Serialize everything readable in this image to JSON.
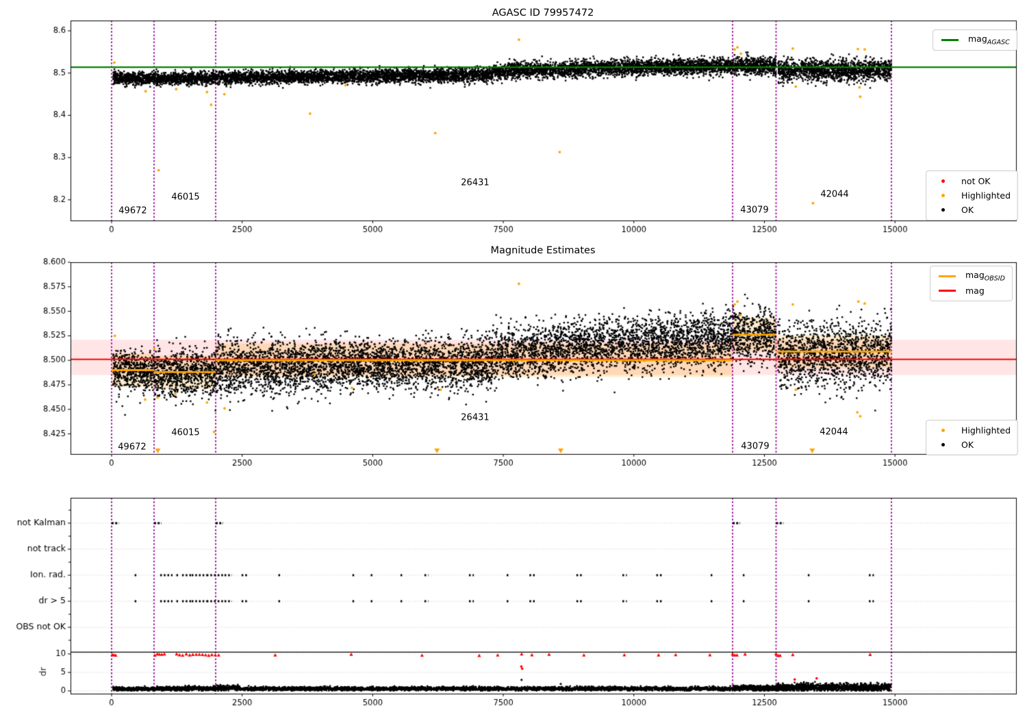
{
  "figure": {
    "top_title": "AGASC ID 79957472",
    "middle_title": "Magnitude Estimates"
  },
  "colors": {
    "ok": "#000000",
    "highlighted": "#ffa500",
    "not_ok": "#ff0000",
    "mag_agasc_line": "#008000",
    "mag_line": "#ff0000",
    "mag_obsid_line": "#ffa500",
    "obsid_boundary": "#990099",
    "mag_band_fill": "rgba(255,0,0,0.10)",
    "obsid_band_fill": "rgba(255,165,0,0.20)",
    "grid": "#c8c8c8",
    "threshold_line": "#000000"
  },
  "obsids": [
    {
      "id": "49672",
      "start": 0,
      "end": 813
    },
    {
      "id": "46015",
      "start": 813,
      "end": 1993
    },
    {
      "id": "26431",
      "start": 1993,
      "end": 11891
    },
    {
      "id": "43079",
      "start": 11891,
      "end": 12723
    },
    {
      "id": "42044",
      "start": 12723,
      "end": 14932
    }
  ],
  "chart_data": [
    {
      "type": "scatter",
      "title": "AGASC ID 79957472",
      "x_ticks": [
        0,
        2500,
        5000,
        7500,
        10000,
        12500,
        15000
      ],
      "y_ticks": [
        8.6,
        8.5,
        8.4,
        8.3,
        8.2
      ],
      "y_tick_decimals": 1,
      "ylim": [
        8.151,
        8.624
      ],
      "mag_agasc": 8.514,
      "boundaries": [
        0,
        813,
        1993,
        11891,
        12723,
        14932
      ],
      "legend_top": [
        {
          "marker": "line",
          "color": "#008000",
          "label": "mag",
          "sub": "AGASC"
        }
      ],
      "legend_bottom": [
        {
          "marker": "dot",
          "color": "#ff0000",
          "label": "not OK"
        },
        {
          "marker": "dot",
          "color": "#ffa500",
          "label": "Highlighted"
        },
        {
          "marker": "dot",
          "color": "#000000",
          "label": "OK"
        }
      ],
      "band_segments": [
        {
          "x0": 30,
          "x1": 813,
          "m0": 8.488,
          "m1": 8.487,
          "std": 0.0075,
          "n": 500
        },
        {
          "x0": 813,
          "x1": 1993,
          "m0": 8.487,
          "m1": 8.488,
          "std": 0.0075,
          "n": 750
        },
        {
          "x0": 1993,
          "x1": 5000,
          "m0": 8.489,
          "m1": 8.4925,
          "std": 0.0075,
          "n": 1900
        },
        {
          "x0": 5000,
          "x1": 7300,
          "m0": 8.4925,
          "m1": 8.497,
          "std": 0.008,
          "n": 1450
        },
        {
          "x0": 7300,
          "x1": 9000,
          "m0": 8.503,
          "m1": 8.51,
          "std": 0.0095,
          "n": 1050
        },
        {
          "x0": 9000,
          "x1": 11891,
          "m0": 8.511,
          "m1": 8.517,
          "std": 0.0095,
          "n": 1800
        },
        {
          "x0": 11891,
          "x1": 12723,
          "m0": 8.517,
          "m1": 8.517,
          "std": 0.011,
          "n": 520
        },
        {
          "x0": 12760,
          "x1": 14932,
          "m0": 8.506,
          "m1": 8.508,
          "std": 0.013,
          "n": 1350
        }
      ],
      "tail": 0.008,
      "tail_prob": 0.05,
      "highlighted": [
        [
          52,
          8.525
        ],
        [
          651,
          8.457
        ],
        [
          900,
          8.27
        ],
        [
          1236,
          8.462
        ],
        [
          1827,
          8.455
        ],
        [
          1905,
          8.425
        ],
        [
          2159,
          8.45
        ],
        [
          3800,
          8.404
        ],
        [
          4480,
          8.471
        ],
        [
          6197,
          8.358
        ],
        [
          7800,
          8.579
        ],
        [
          8580,
          8.313
        ],
        [
          11930,
          8.556
        ],
        [
          11983,
          8.561
        ],
        [
          12050,
          8.546
        ],
        [
          13043,
          8.558
        ],
        [
          13100,
          8.468
        ],
        [
          13430,
          8.192
        ],
        [
          14290,
          8.557
        ],
        [
          14420,
          8.556
        ],
        [
          14320,
          8.466
        ],
        [
          14335,
          8.444
        ]
      ],
      "obsid_labels": [
        {
          "text": "49672",
          "x": 406,
          "y": 8.174
        },
        {
          "text": "46015",
          "x": 1416,
          "y": 8.206
        },
        {
          "text": "26431",
          "x": 6961,
          "y": 8.24
        },
        {
          "text": "43079",
          "x": 12310,
          "y": 8.175
        },
        {
          "text": "42044",
          "x": 13844,
          "y": 8.213
        }
      ]
    },
    {
      "type": "scatter",
      "title": "Magnitude Estimates",
      "x_ticks": [
        0,
        2500,
        5000,
        7500,
        10000,
        12500,
        15000
      ],
      "y_ticks": [
        8.6,
        8.575,
        8.55,
        8.525,
        8.5,
        8.475,
        8.45,
        8.425
      ],
      "y_tick_decimals": 3,
      "ylim": [
        8.404,
        8.6
      ],
      "mag": 8.501,
      "mag_band": [
        8.485,
        8.521
      ],
      "obsid_band_halfwidth": 0.017,
      "boundaries": [
        0,
        813,
        1993,
        11891,
        12723,
        14932
      ],
      "mag_obsid_segments": [
        {
          "x0": 0,
          "x1": 813,
          "y": 8.49
        },
        {
          "x0": 813,
          "x1": 1993,
          "y": 8.488
        },
        {
          "x0": 1993,
          "x1": 11891,
          "y": 8.5
        },
        {
          "x0": 11891,
          "x1": 12723,
          "y": 8.526
        },
        {
          "x0": 12723,
          "x1": 14932,
          "y": 8.509
        }
      ],
      "legend_top": [
        {
          "marker": "line",
          "color": "#ffa500",
          "label": "mag",
          "sub": "OBSID"
        },
        {
          "marker": "line",
          "color": "#ff0000",
          "label": "mag"
        }
      ],
      "legend_bottom": [
        {
          "marker": "dot",
          "color": "#ffa500",
          "label": "Highlighted"
        },
        {
          "marker": "dot",
          "color": "#000000",
          "label": "OK"
        }
      ],
      "band_segments": [
        {
          "x0": 30,
          "x1": 813,
          "m0": 8.49,
          "m1": 8.489,
          "std": 0.009,
          "n": 500
        },
        {
          "x0": 813,
          "x1": 1993,
          "m0": 8.488,
          "m1": 8.489,
          "std": 0.011,
          "n": 750
        },
        {
          "x0": 1993,
          "x1": 2450,
          "m0": 8.492,
          "m1": 8.492,
          "std": 0.015,
          "n": 300
        },
        {
          "x0": 2450,
          "x1": 5000,
          "m0": 8.494,
          "m1": 8.496,
          "std": 0.013,
          "n": 1650
        },
        {
          "x0": 5000,
          "x1": 7300,
          "m0": 8.496,
          "m1": 8.498,
          "std": 0.012,
          "n": 1450
        },
        {
          "x0": 7300,
          "x1": 9000,
          "m0": 8.505,
          "m1": 8.515,
          "std": 0.013,
          "n": 1050
        },
        {
          "x0": 9000,
          "x1": 11891,
          "m0": 8.516,
          "m1": 8.523,
          "std": 0.013,
          "n": 1800
        },
        {
          "x0": 11891,
          "x1": 12723,
          "m0": 8.527,
          "m1": 8.527,
          "std": 0.013,
          "n": 520
        },
        {
          "x0": 12760,
          "x1": 14932,
          "m0": 8.504,
          "m1": 8.508,
          "std": 0.016,
          "n": 1350
        }
      ],
      "tail": 0.022,
      "tail_prob": 0.08,
      "highlighted": [
        [
          62,
          8.525
        ],
        [
          642,
          8.46
        ],
        [
          817,
          8.512
        ],
        [
          880,
          8.462
        ],
        [
          1223,
          8.466
        ],
        [
          1826,
          8.457
        ],
        [
          1962,
          8.427
        ],
        [
          2163,
          8.451
        ],
        [
          3893,
          8.486
        ],
        [
          4600,
          8.472
        ],
        [
          6300,
          8.47
        ],
        [
          7800,
          8.578
        ],
        [
          11930,
          8.557
        ],
        [
          11983,
          8.56
        ],
        [
          12040,
          8.546
        ],
        [
          13043,
          8.557
        ],
        [
          13100,
          8.47
        ],
        [
          14280,
          8.447
        ],
        [
          14300,
          8.56
        ],
        [
          14335,
          8.443
        ],
        [
          14420,
          8.558
        ]
      ],
      "clip_triangles_x": [
        885,
        6230,
        8600,
        13415
      ],
      "obsid_labels": [
        {
          "text": "49672",
          "x": 393,
          "y": 8.4114
        },
        {
          "text": "46015",
          "x": 1416,
          "y": 8.4261
        },
        {
          "text": "26431",
          "x": 6961,
          "y": 8.4415
        },
        {
          "text": "43079",
          "x": 12323,
          "y": 8.4121
        },
        {
          "text": "42044",
          "x": 13830,
          "y": 8.4268
        }
      ]
    },
    {
      "type": "flags",
      "categories": [
        "not Kalman",
        "not track",
        "Ion. rad.",
        "dr > 5",
        "OBS not OK"
      ],
      "dr_ticks": [
        10,
        5,
        0
      ],
      "ylabel": "dr",
      "x_ticks": [
        0,
        2500,
        5000,
        7500,
        10000,
        12500,
        15000
      ],
      "threshold": 10.5,
      "boundaries": [
        0,
        813,
        1993,
        11891,
        12723,
        14932
      ],
      "not_kalman_ranges": [
        [
          0,
          115
        ],
        [
          813,
          930
        ],
        [
          1993,
          2110
        ],
        [
          11891,
          12010
        ],
        [
          12723,
          12840
        ]
      ],
      "flag_ranges": [
        [
          441,
          460
        ],
        [
          930,
          1140
        ],
        [
          1240,
          1258
        ],
        [
          1349,
          1506
        ],
        [
          1533,
          1795
        ],
        [
          1821,
          2004
        ],
        [
          2031,
          2122
        ],
        [
          2162,
          2280
        ],
        [
          2489,
          2581
        ],
        [
          3193,
          3220
        ],
        [
          4611,
          4640
        ],
        [
          4961,
          4990
        ],
        [
          5531,
          5560
        ],
        [
          5990,
          6040
        ],
        [
          6843,
          6910
        ],
        [
          7564,
          7600
        ],
        [
          8000,
          8100
        ],
        [
          8900,
          8995
        ],
        [
          9780,
          9840
        ],
        [
          10430,
          10510
        ],
        [
          11470,
          11510
        ],
        [
          12086,
          12115
        ],
        [
          13331,
          13360
        ],
        [
          14500,
          14570
        ]
      ],
      "red_caret_x": [
        13,
        45,
        78,
        830,
        875,
        915,
        960,
        1010,
        1245,
        1300,
        1360,
        1430,
        1495,
        1555,
        1620,
        1680,
        1740,
        1800,
        1860,
        1920,
        1985,
        2050,
        3133,
        4588,
        5944,
        7039,
        7393,
        7851,
        8048,
        8376,
        9044,
        9818,
        10473,
        10801,
        11456,
        11891,
        11935,
        11975,
        12130,
        12723,
        12762,
        12800,
        13043,
        14524
      ],
      "red_points": [
        [
          7846,
          6.6
        ],
        [
          7862,
          6.0
        ],
        [
          13080,
          3.1
        ],
        [
          13500,
          3.4
        ]
      ],
      "black_points": [
        [
          7850,
          3.0
        ],
        [
          8600,
          1.9
        ]
      ],
      "dr_noise_segments": [
        {
          "x0": 30,
          "x1": 813,
          "mean": 0.55,
          "spread": 0.22,
          "n": 350
        },
        {
          "x0": 813,
          "x1": 1993,
          "mean": 0.65,
          "spread": 0.28,
          "n": 520
        },
        {
          "x0": 1993,
          "x1": 2450,
          "mean": 0.85,
          "spread": 0.35,
          "n": 220
        },
        {
          "x0": 2450,
          "x1": 11891,
          "mean": 0.6,
          "spread": 0.25,
          "n": 3400
        },
        {
          "x0": 11891,
          "x1": 12723,
          "mean": 0.75,
          "spread": 0.35,
          "n": 420
        },
        {
          "x0": 12723,
          "x1": 14932,
          "mean": 0.95,
          "spread": 0.5,
          "n": 1150
        }
      ]
    }
  ]
}
